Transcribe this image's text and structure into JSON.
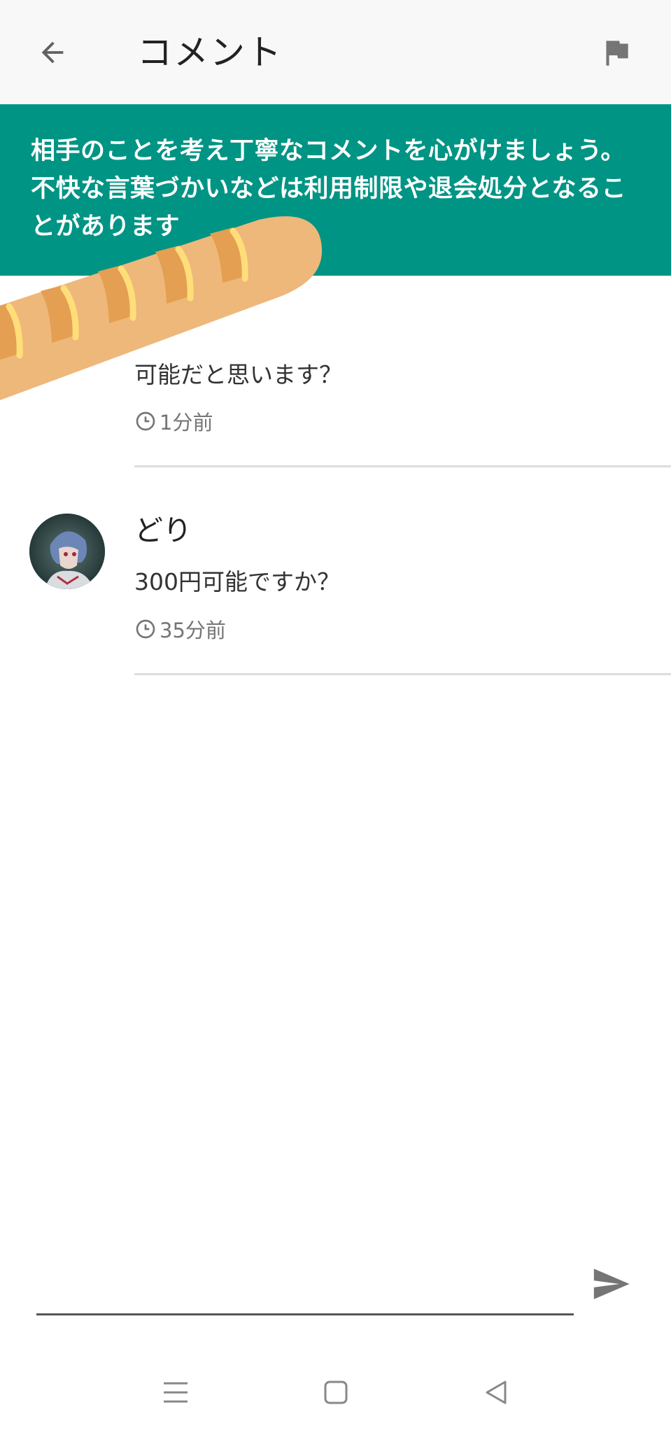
{
  "header": {
    "title": "コメント",
    "back_icon": "arrow-left-icon",
    "flag_icon": "flag-icon"
  },
  "notice": {
    "text": "相手のことを考え丁寧なコメントを心がけましょう。不快な言葉づかいなどは利用制限や退会処分となることがあります",
    "background": "#009484"
  },
  "comments": [
    {
      "author": "",
      "body": "可能だと思います？",
      "time": "1分前"
    },
    {
      "author": "どり",
      "body": "300円可能ですか？",
      "time": "35分前"
    }
  ],
  "composer": {
    "value": "",
    "placeholder": "",
    "send_icon": "send-icon"
  },
  "nav": {
    "menu_icon": "menu-icon",
    "home_icon": "home-square-icon",
    "back_icon": "back-triangle-icon"
  }
}
